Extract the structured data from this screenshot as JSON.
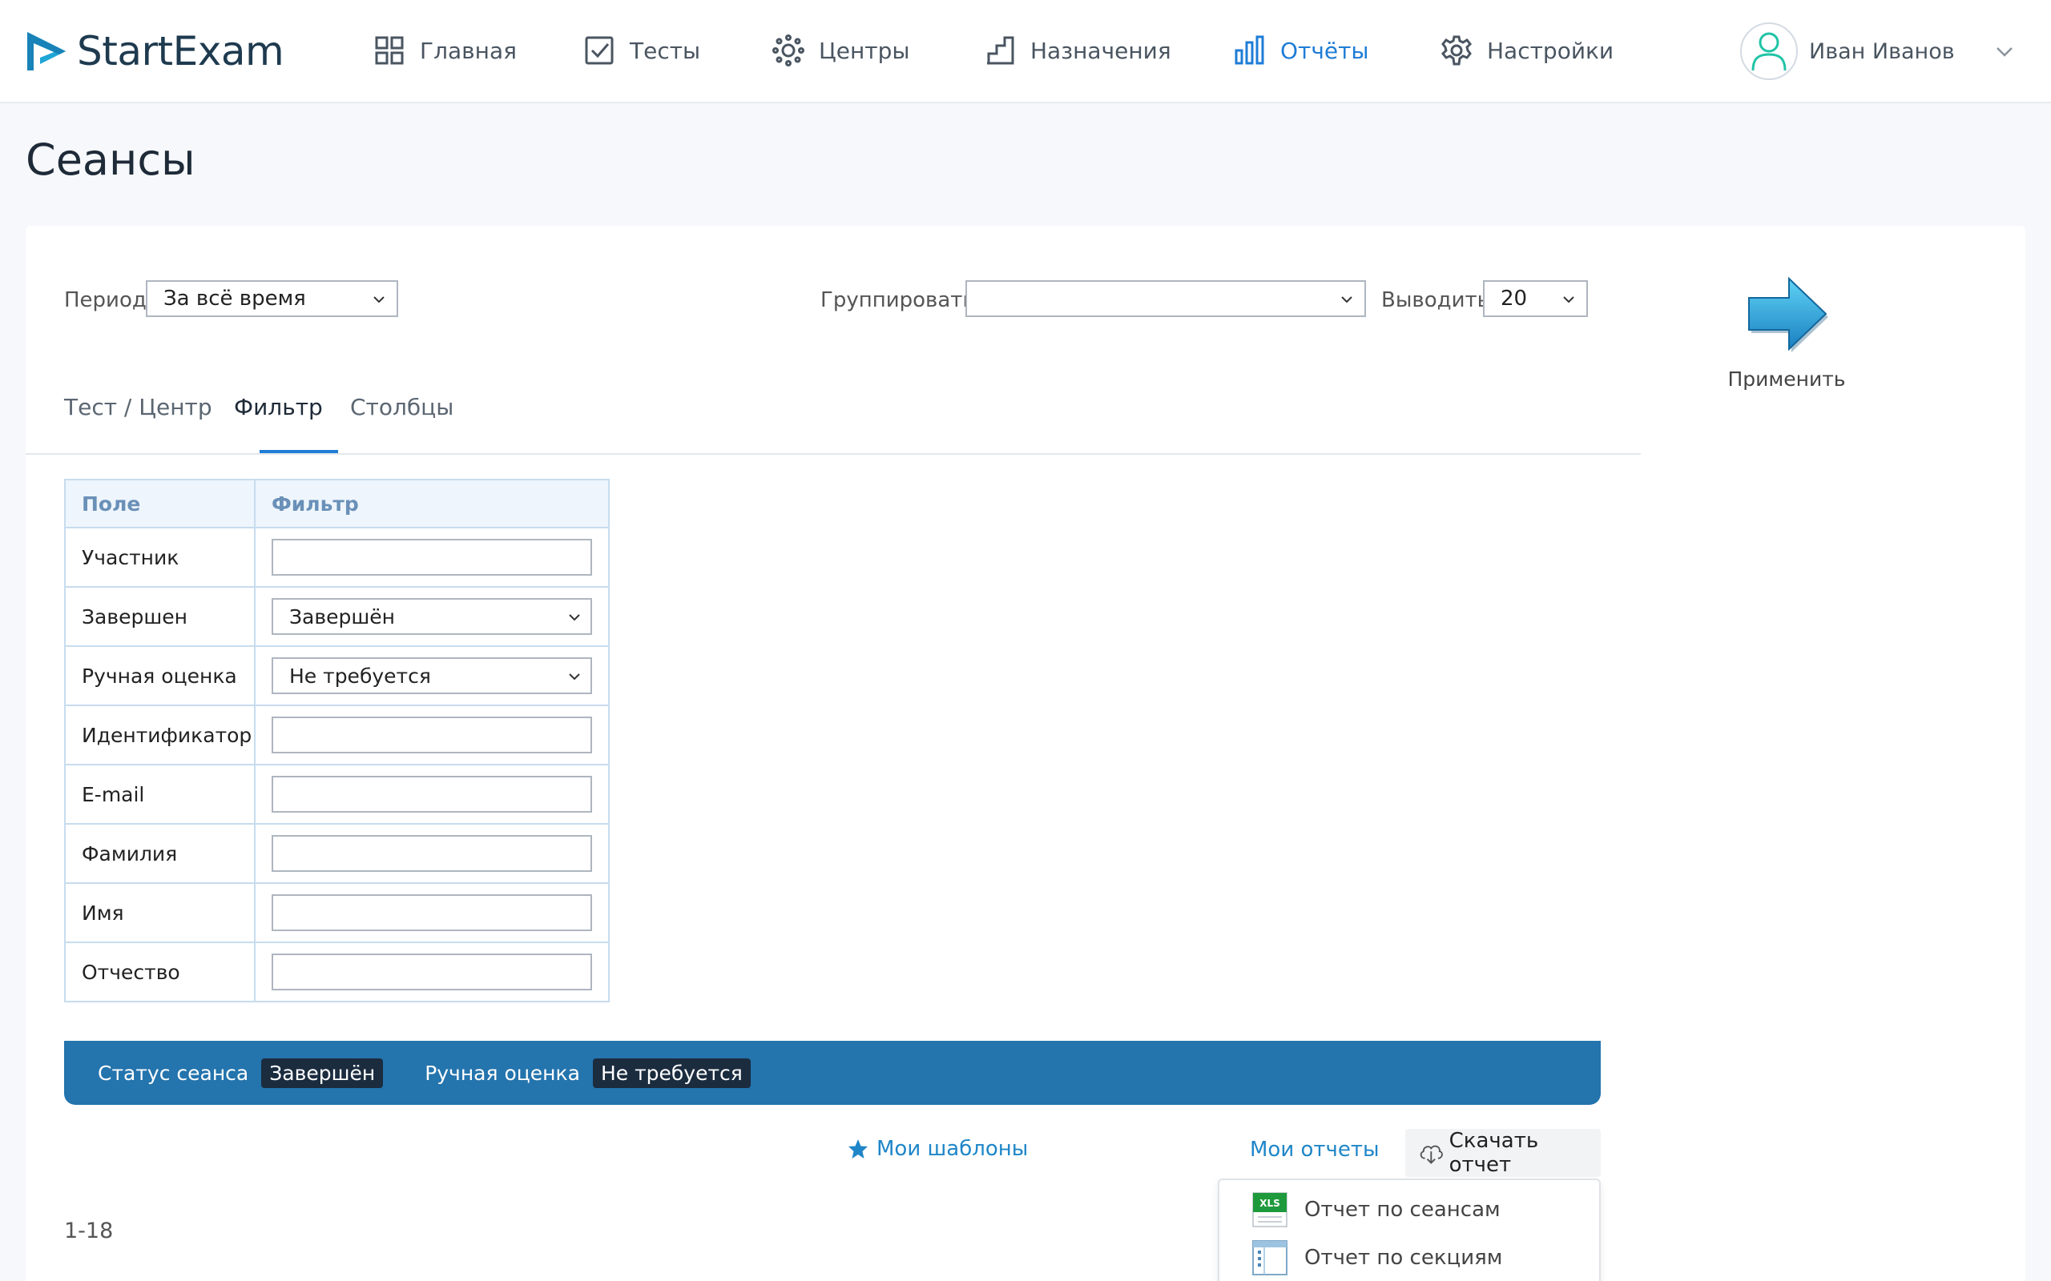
{
  "app": {
    "brand": "StartExam",
    "colors": {
      "primary": "#1f7dd6",
      "accent": "#2474ad",
      "logo": "#1fa6d6"
    }
  },
  "nav": {
    "items": [
      {
        "label": "Главная",
        "icon": "grid-icon"
      },
      {
        "label": "Тесты",
        "icon": "checkbox-icon"
      },
      {
        "label": "Центры",
        "icon": "sun-icon"
      },
      {
        "label": "Назначения",
        "icon": "stairs-icon"
      },
      {
        "label": "Отчёты",
        "icon": "bar-chart-icon",
        "active": true
      },
      {
        "label": "Настройки",
        "icon": "gear-icon"
      }
    ]
  },
  "user": {
    "name": "Иван Иванов"
  },
  "page": {
    "title": "Сеансы"
  },
  "controls": {
    "period_label": "Период",
    "period_value": "За всё время",
    "group_label": "Группировать",
    "group_value": "",
    "output_label": "Выводить",
    "output_value": "20",
    "apply_label": "Применить"
  },
  "tabs": [
    {
      "label": "Тест / Центр"
    },
    {
      "label": "Фильтр",
      "active": true
    },
    {
      "label": "Столбцы"
    }
  ],
  "filter_table": {
    "headers": [
      "Поле",
      "Фильтр"
    ],
    "rows": [
      {
        "field": "Участник",
        "type": "input",
        "value": ""
      },
      {
        "field": "Завершен",
        "type": "select",
        "value": "Завершён"
      },
      {
        "field": "Ручная оценка",
        "type": "select",
        "value": "Не требуется"
      },
      {
        "field": "Идентификатор",
        "type": "input",
        "value": ""
      },
      {
        "field": "E-mail",
        "type": "input",
        "value": ""
      },
      {
        "field": "Фамилия",
        "type": "input",
        "value": ""
      },
      {
        "field": "Имя",
        "type": "input",
        "value": ""
      },
      {
        "field": "Отчество",
        "type": "input",
        "value": ""
      }
    ]
  },
  "status_bar": {
    "items": [
      {
        "label": "Статус сеанса",
        "value": "Завершён"
      },
      {
        "label": "Ручная оценка",
        "value": "Не требуется"
      }
    ]
  },
  "actions": {
    "templates": "Мои шаблоны",
    "my_reports": "Мои отчеты",
    "download": "Скачать отчет"
  },
  "pager": {
    "range": "1-18"
  },
  "download_menu": {
    "items": [
      {
        "label": "Отчет по сеансам",
        "icon": "xls-file-icon",
        "badge": "XLS"
      },
      {
        "label": "Отчет по секциям",
        "icon": "sections-file-icon"
      }
    ]
  }
}
